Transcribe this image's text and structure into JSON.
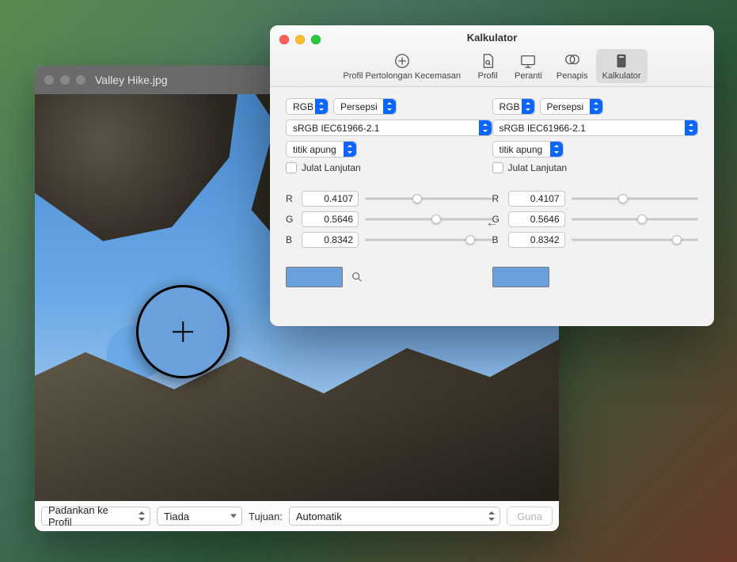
{
  "image_window": {
    "title": "Valley Hike.jpg",
    "toolbar": {
      "match_to_profile": {
        "label": "Padankan ke Profil"
      },
      "profile_select": {
        "value": "Tiada"
      },
      "destination_label": "Tujuan:",
      "destination_select": {
        "value": "Automatik"
      },
      "apply_button": {
        "label": "Guna"
      }
    }
  },
  "colorsync_window": {
    "title": "Kalkulator",
    "tabs": [
      {
        "id": "first-aid",
        "label": "Profil Pertolongan Kecemasan"
      },
      {
        "id": "profile",
        "label": "Profil"
      },
      {
        "id": "device",
        "label": "Peranti"
      },
      {
        "id": "filter",
        "label": "Penapis"
      },
      {
        "id": "calculator",
        "label": "Kalkulator",
        "active": true
      }
    ],
    "arrow_direction": "←",
    "left": {
      "model": {
        "value": "RGB"
      },
      "intent": {
        "value": "Persepsi"
      },
      "profile": {
        "value": "sRGB IEC61966-2.1"
      },
      "format": {
        "value": "titik apung"
      },
      "extended_range": {
        "label": "Julat Lanjutan",
        "checked": false
      },
      "channels": [
        {
          "label": "R",
          "value": "0.4107",
          "pos": 0.41
        },
        {
          "label": "G",
          "value": "0.5646",
          "pos": 0.56
        },
        {
          "label": "B",
          "value": "0.8342",
          "pos": 0.83
        }
      ],
      "swatch_color": "#6aa0dc"
    },
    "right": {
      "model": {
        "value": "RGB"
      },
      "intent": {
        "value": "Persepsi"
      },
      "profile": {
        "value": "sRGB IEC61966-2.1"
      },
      "format": {
        "value": "titik apung"
      },
      "extended_range": {
        "label": "Julat Lanjutan",
        "checked": false
      },
      "channels": [
        {
          "label": "R",
          "value": "0.4107",
          "pos": 0.41
        },
        {
          "label": "G",
          "value": "0.5646",
          "pos": 0.56
        },
        {
          "label": "B",
          "value": "0.8342",
          "pos": 0.83
        }
      ],
      "swatch_color": "#6aa0dc"
    }
  }
}
